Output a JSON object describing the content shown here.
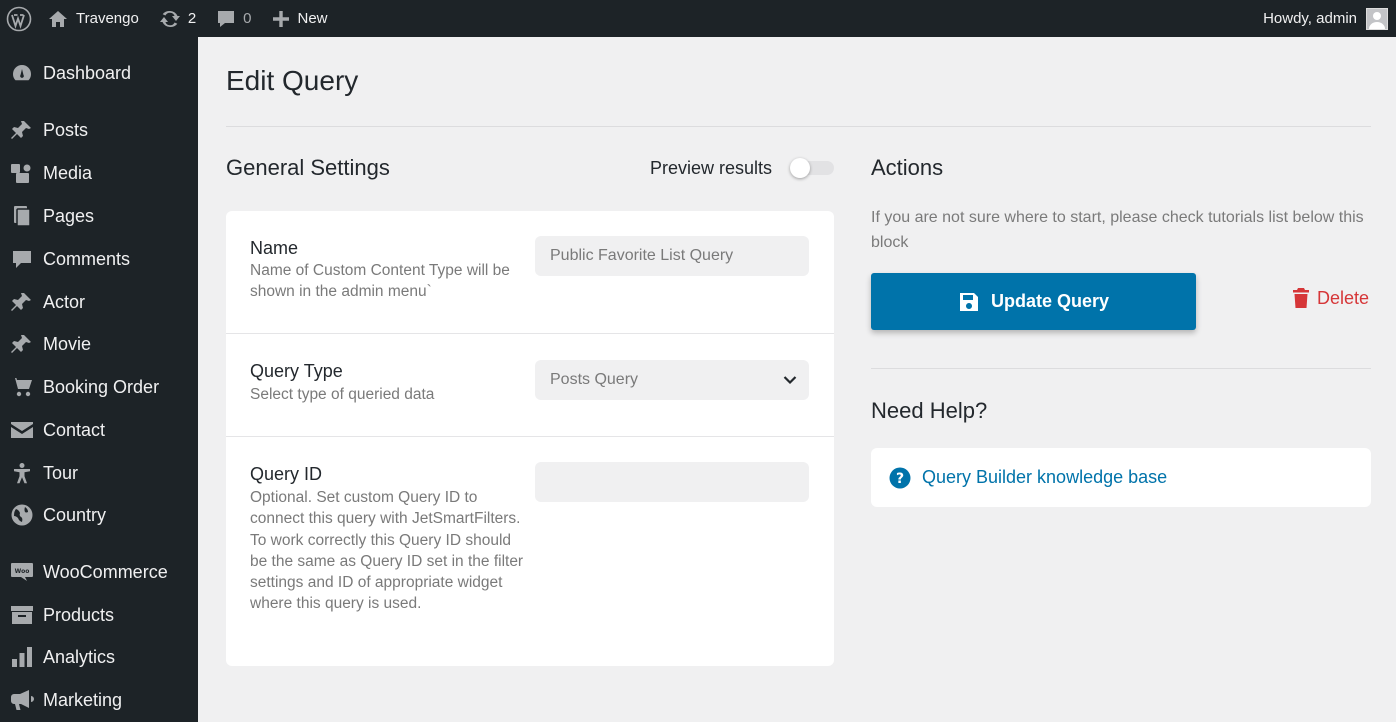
{
  "admin_bar": {
    "site_name": "Travengo",
    "updates_count": "2",
    "comments_count": "0",
    "new_label": "New",
    "greeting": "Howdy, admin"
  },
  "sidebar": {
    "items": [
      {
        "label": "Dashboard",
        "icon": "dashboard-icon"
      },
      {
        "label": "Posts",
        "icon": "pin-icon"
      },
      {
        "label": "Media",
        "icon": "media-icon"
      },
      {
        "label": "Pages",
        "icon": "pages-icon"
      },
      {
        "label": "Comments",
        "icon": "comment-icon"
      },
      {
        "label": "Actor",
        "icon": "pin-icon"
      },
      {
        "label": "Movie",
        "icon": "pin-icon"
      },
      {
        "label": "Booking Order",
        "icon": "cart-icon"
      },
      {
        "label": "Contact",
        "icon": "email-icon"
      },
      {
        "label": "Tour",
        "icon": "universal-access-icon"
      },
      {
        "label": "Country",
        "icon": "globe-icon"
      },
      {
        "label": "WooCommerce",
        "icon": "woo-icon"
      },
      {
        "label": "Products",
        "icon": "archive-icon"
      },
      {
        "label": "Analytics",
        "icon": "bar-chart-icon"
      },
      {
        "label": "Marketing",
        "icon": "megaphone-icon"
      }
    ]
  },
  "page": {
    "title": "Edit Query"
  },
  "general": {
    "title": "General Settings",
    "preview_label": "Preview results",
    "preview_enabled": false
  },
  "fields": {
    "name": {
      "title": "Name",
      "description": "Name of Custom Content Type will be shown in the admin menu`",
      "value": "Public Favorite List Query"
    },
    "query_type": {
      "title": "Query Type",
      "description": "Select type of queried data",
      "value": "Posts Query"
    },
    "query_id": {
      "title": "Query ID",
      "description": "Optional. Set custom Query ID to connect this query with JetSmartFilters. To work correctly this Query ID should be the same as Query ID set in the filter settings and ID of appropriate widget where this query is used.",
      "value": ""
    }
  },
  "actions": {
    "title": "Actions",
    "help_text": "If you are not sure where to start, please check tutorials list below this block",
    "update_label": "Update Query",
    "delete_label": "Delete"
  },
  "help": {
    "title": "Need Help?",
    "link_label": "Query Builder knowledge base"
  },
  "colors": {
    "primary": "#0073aa",
    "danger": "#d63638",
    "admin_bg": "#1d2327",
    "page_bg": "#f0f0f1"
  }
}
